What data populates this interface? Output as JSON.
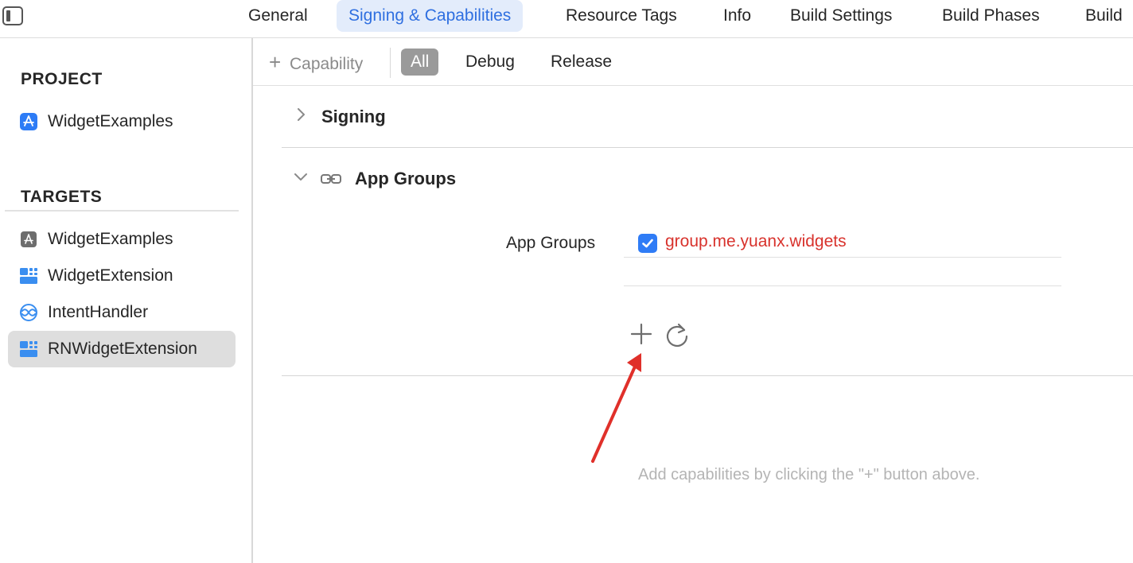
{
  "tabs": [
    {
      "label": "General"
    },
    {
      "label": "Signing & Capabilities",
      "active": true
    },
    {
      "label": "Resource Tags"
    },
    {
      "label": "Info"
    },
    {
      "label": "Build Settings"
    },
    {
      "label": "Build Phases"
    },
    {
      "label": "Build"
    }
  ],
  "sidebar": {
    "project_header": "PROJECT",
    "project_items": [
      {
        "label": "WidgetExamples",
        "icon": "app-store-icon"
      }
    ],
    "targets_header": "TARGETS",
    "target_items": [
      {
        "label": "WidgetExamples",
        "icon": "app-icon"
      },
      {
        "label": "WidgetExtension",
        "icon": "widget-extension-icon"
      },
      {
        "label": "IntentHandler",
        "icon": "intent-handler-icon"
      },
      {
        "label": "RNWidgetExtension",
        "icon": "widget-extension-icon",
        "selected": true
      }
    ]
  },
  "toolbar": {
    "add_capability": "Capability",
    "filters": [
      "All",
      "Debug",
      "Release"
    ],
    "active_filter": "All"
  },
  "sections": {
    "signing_title": "Signing",
    "app_groups_title": "App Groups"
  },
  "app_groups": {
    "label": "App Groups",
    "items": [
      {
        "value": "group.me.yuanx.widgets",
        "checked": true
      }
    ]
  },
  "hint": "Add capabilities by clicking the \"+\" button above.",
  "colors": {
    "accent": "#2f7cf6",
    "active_tab_text": "#2f6fe0",
    "group_text": "#d8322c",
    "annotation_arrow": "#e0302a"
  }
}
